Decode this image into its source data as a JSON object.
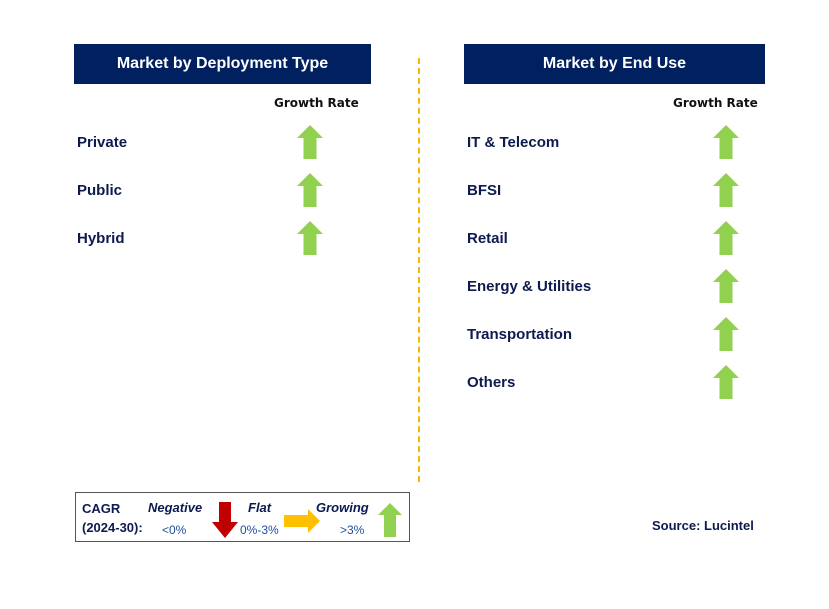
{
  "left_panel": {
    "title": "Market by Deployment Type",
    "growth_label": "Growth Rate",
    "items": [
      {
        "label": "Private",
        "trend": "growing"
      },
      {
        "label": "Public",
        "trend": "growing"
      },
      {
        "label": "Hybrid",
        "trend": "growing"
      }
    ]
  },
  "right_panel": {
    "title": "Market by End Use",
    "growth_label": "Growth Rate",
    "items": [
      {
        "label": "IT & Telecom",
        "trend": "growing"
      },
      {
        "label": "BFSI",
        "trend": "growing"
      },
      {
        "label": "Retail",
        "trend": "growing"
      },
      {
        "label": "Energy & Utilities",
        "trend": "growing"
      },
      {
        "label": "Transportation",
        "trend": "growing"
      },
      {
        "label": "Others",
        "trend": "growing"
      }
    ]
  },
  "legend": {
    "cagr": "CAGR",
    "period": "(2024-30):",
    "negative": "Negative",
    "negative_range": "<0%",
    "flat": "Flat",
    "flat_range": "0%-3%",
    "growing": "Growing",
    "growing_range": ">3%"
  },
  "source": "Source: Lucintel",
  "colors": {
    "header": "#002060",
    "growing": "#92D050",
    "flat": "#FFC000",
    "negative": "#C00000",
    "divider": "#F5B800"
  }
}
